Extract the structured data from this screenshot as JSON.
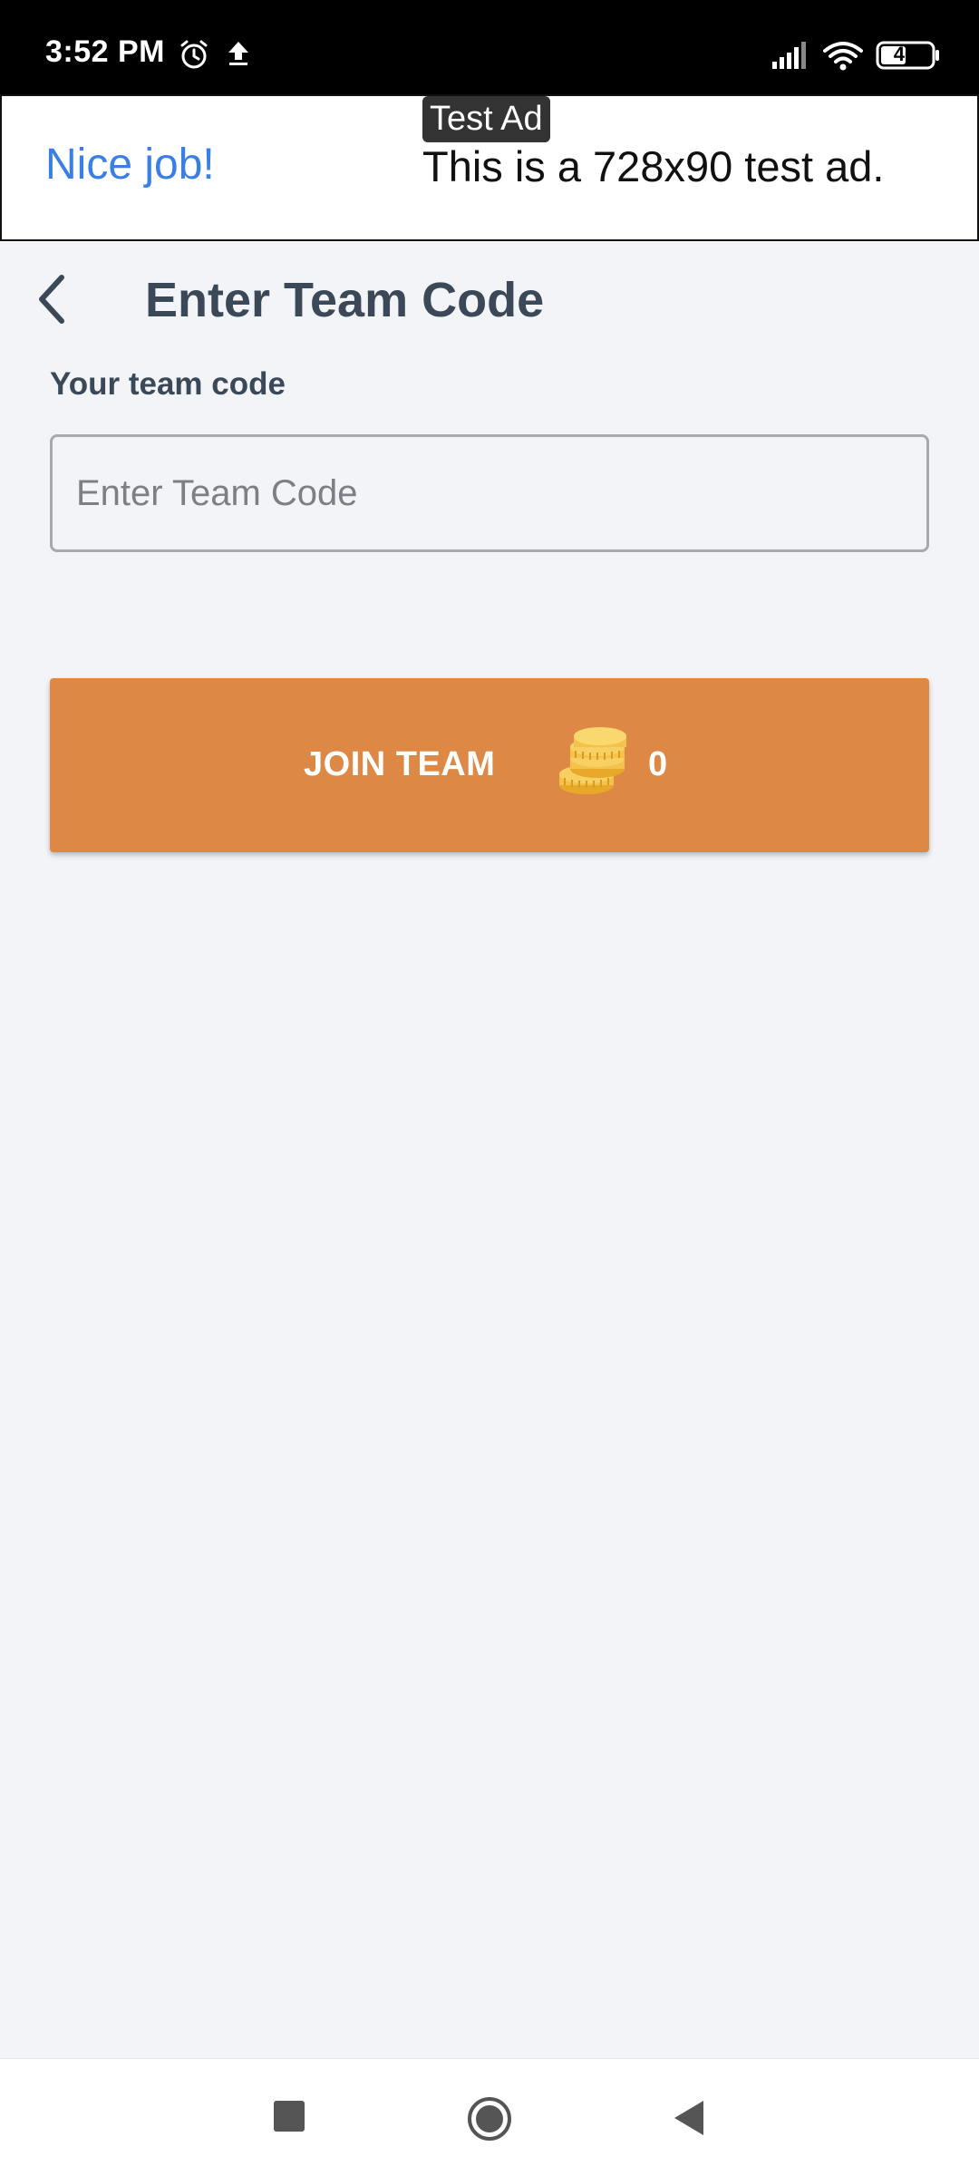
{
  "status_bar": {
    "time": "3:52 PM",
    "battery": "46",
    "icons": [
      "alarm-icon",
      "upload-icon",
      "signal-icon",
      "wifi-icon",
      "battery-icon"
    ]
  },
  "ad": {
    "title": "Nice job!",
    "badge": "Test Ad",
    "text": "This is a 728x90 test ad."
  },
  "header": {
    "title": "Enter Team Code",
    "back_icon": "chevron-left-icon"
  },
  "form": {
    "label": "Your team code",
    "placeholder": "Enter Team Code",
    "value": ""
  },
  "join_button": {
    "label": "JOIN TEAM",
    "coin_count": "0",
    "icon": "coins-icon"
  },
  "nav": {
    "icons": [
      "recents-icon",
      "home-icon",
      "back-icon"
    ]
  },
  "colors": {
    "accent": "#de8846",
    "background": "#f2f4f8",
    "title_text": "#3b4858",
    "ad_link": "#3a7fe6"
  }
}
